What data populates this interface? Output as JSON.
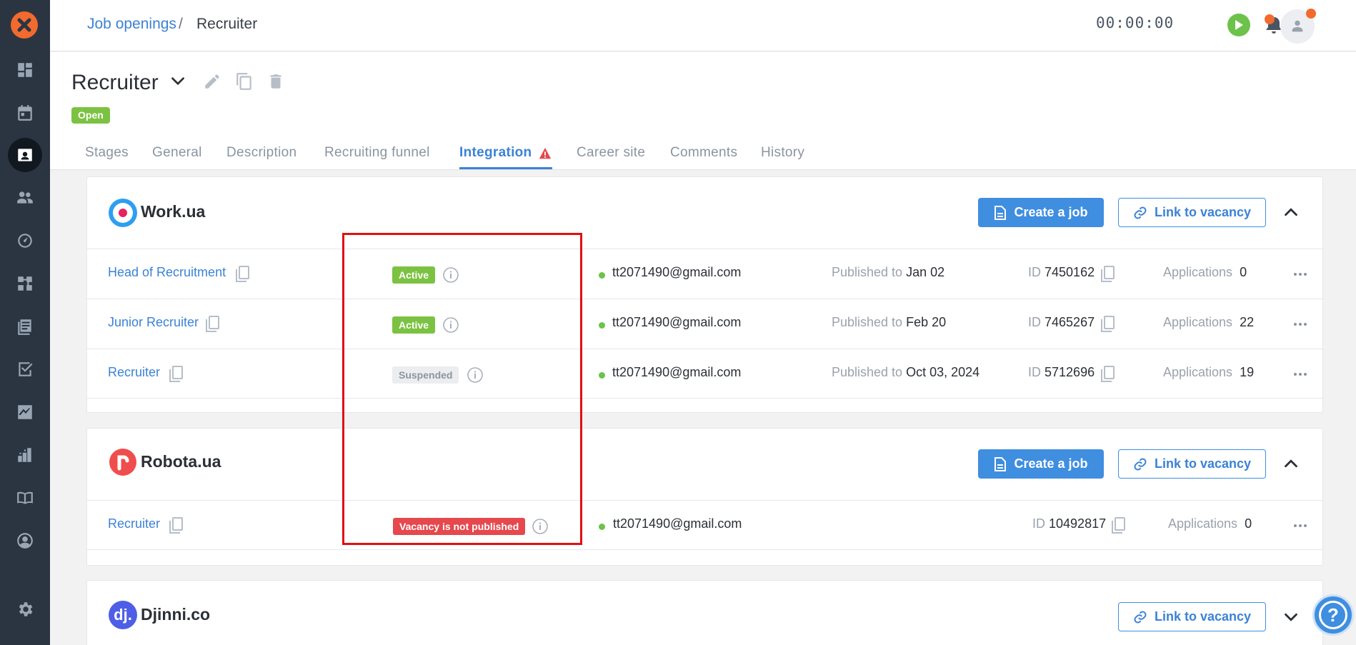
{
  "breadcrumb": {
    "link": "Job openings",
    "separator": "/",
    "current": "Recruiter"
  },
  "topbar": {
    "timer": "00:00:00"
  },
  "header": {
    "title": "Recruiter",
    "status": "Open",
    "tabs": [
      {
        "label": "Stages"
      },
      {
        "label": "General"
      },
      {
        "label": "Description"
      },
      {
        "label": "Recruiting funnel"
      },
      {
        "label": "Integration"
      },
      {
        "label": "Career site"
      },
      {
        "label": "Comments"
      },
      {
        "label": "History"
      }
    ]
  },
  "labels": {
    "create_job": "Create a job",
    "link_vacancy": "Link to vacancy",
    "published_to": "Published to",
    "id": "ID",
    "applications": "Applications"
  },
  "integrations": [
    {
      "name": "Work.ua",
      "rows": [
        {
          "title": "Head of Recruitment",
          "status": "Active",
          "email": "tt2071490@gmail.com",
          "published": "Jan 02",
          "id": "7450162",
          "applications": "0"
        },
        {
          "title": "Junior Recruiter",
          "status": "Active",
          "email": "tt2071490@gmail.com",
          "published": "Feb 20",
          "id": "7465267",
          "applications": "22"
        },
        {
          "title": "Recruiter",
          "status": "Suspended",
          "email": "tt2071490@gmail.com",
          "published": "Oct 03, 2024",
          "id": "5712696",
          "applications": "19"
        }
      ]
    },
    {
      "name": "Robota.ua",
      "rows": [
        {
          "title": "Recruiter",
          "status": "Vacancy is not published",
          "email": "tt2071490@gmail.com",
          "id": "10492817",
          "applications": "0"
        }
      ]
    },
    {
      "name": "Djinni.co",
      "logo_text": "dj."
    }
  ],
  "colors": {
    "accent": "#3b82d6",
    "active": "#7cc242",
    "danger": "#e5484d",
    "sidebar": "#2b3542",
    "brand": "#f26a2e"
  }
}
